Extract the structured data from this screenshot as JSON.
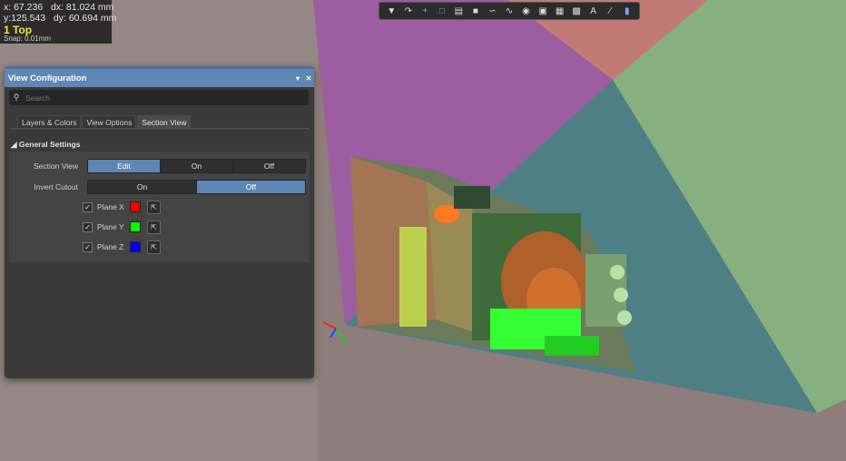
{
  "readout": {
    "x": "x: 67.236",
    "dx": "dx: 81.024 mm",
    "y": "y:125.543",
    "dy": "dy: 60.694 mm",
    "layer": "1 Top",
    "snap": "Snap: 0.01mm"
  },
  "toolbar": {
    "icons": [
      "filter-icon",
      "route-icon",
      "plus-icon",
      "select-rect-icon",
      "chart-icon",
      "component-icon",
      "wire-icon",
      "diff-pair-icon",
      "pin-icon",
      "fill-icon",
      "region-icon",
      "graph-icon",
      "text-icon",
      "line-icon",
      "3d-shield-icon"
    ]
  },
  "panel": {
    "title": "View Configuration",
    "search_placeholder": "Search",
    "tabs": [
      "Layers & Colors",
      "View Options",
      "Section View"
    ],
    "active_tab": "Section View",
    "section_title": "General Settings",
    "section_view": {
      "label": "Section View",
      "options": [
        "Edit",
        "On",
        "Off"
      ],
      "selected": "Edit"
    },
    "invert_cutout": {
      "label": "Invert Cutout",
      "options": [
        "On",
        "Off"
      ],
      "selected": "Off"
    },
    "planes": [
      {
        "label": "Plane X",
        "checked": true,
        "color": "#ff0000"
      },
      {
        "label": "Plane Y",
        "checked": true,
        "color": "#00ff00"
      },
      {
        "label": "Plane Z",
        "checked": true,
        "color": "#0000ff"
      }
    ]
  },
  "colors": {
    "header": "#5f86b4",
    "selected": "#5e86b2",
    "magenta_plane": "#9c5ea0",
    "green_plane": "#86b07e",
    "teal_plane": "#4e7f84",
    "layer_text": "#f5e63a"
  }
}
